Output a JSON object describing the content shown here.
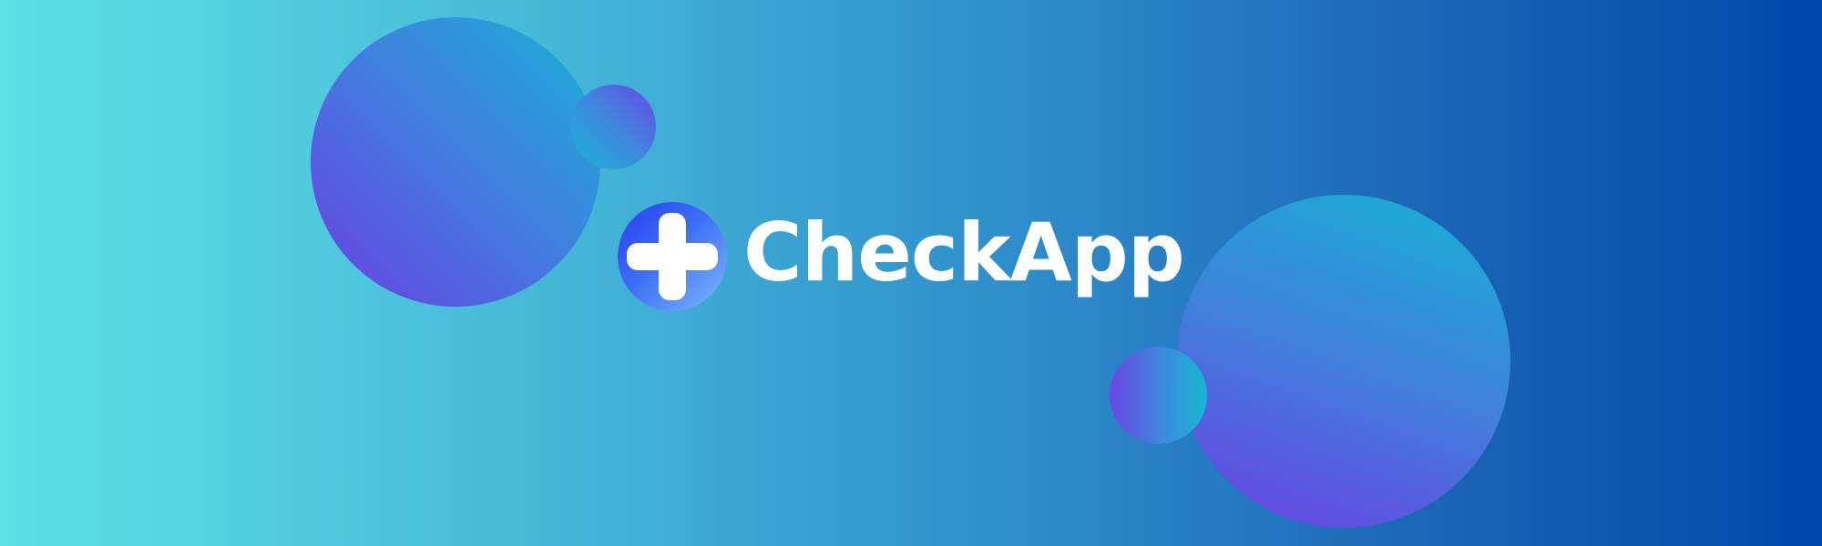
{
  "banner": {
    "brand_name": "CheckApp",
    "logo_icon": "plus-circle-icon",
    "colors": {
      "background_start": "#5fe0e4",
      "background_end": "#0048a8",
      "bubble_purple": "#6a3ee2",
      "bubble_cyan": "#18b1d6",
      "logo_circle_start": "#2a3cf2",
      "logo_circle_end": "#7fb8ff",
      "text": "#ffffff"
    }
  }
}
